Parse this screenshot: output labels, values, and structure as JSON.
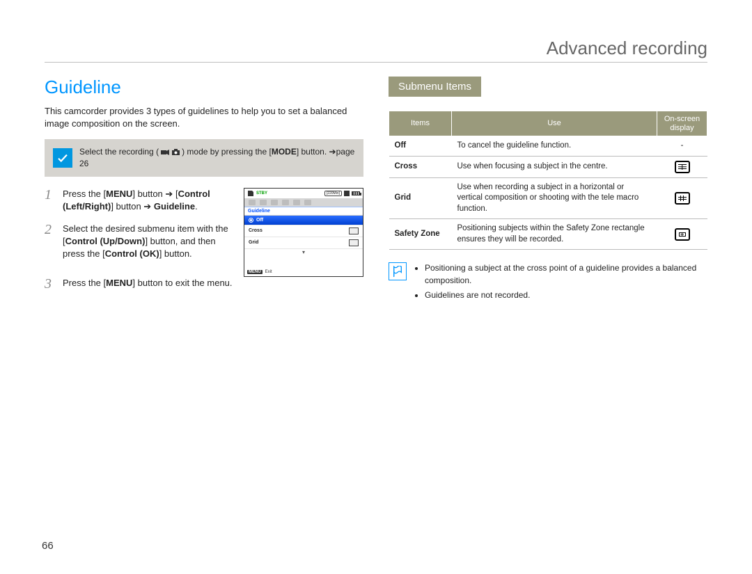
{
  "chapter_title": "Advanced recording",
  "section_title": "Guideline",
  "intro": "This camcorder provides 3 types of guidelines to help you to set a balanced image composition on the screen.",
  "callout": {
    "prefix": "Select the recording (",
    "suffix": ") mode by pressing the [",
    "bold": "MODE",
    "after": "] button. ",
    "arrow": "➔",
    "page_ref": "page 26"
  },
  "steps": [
    {
      "num": "1",
      "parts": {
        "a": "Press the [",
        "a_bold": "MENU",
        "b": "] button ",
        "arrow1": "➔",
        "c": " [",
        "c_bold": "Control (Left/Right)",
        "d": "] button ",
        "arrow2": "➔",
        "e_bold": "Guideline",
        "f": "."
      }
    },
    {
      "num": "2",
      "parts": {
        "a": "Select the desired submenu item with the [",
        "a_bold": "Control (Up/Down)",
        "b": "] button, and then press the [",
        "b_bold": "Control (OK)",
        "c": "] button."
      }
    },
    {
      "num": "3",
      "parts": {
        "a": "Press the [",
        "a_bold": "MENU",
        "b": "] button to exit the menu."
      }
    }
  ],
  "lcd": {
    "stby": "STBY",
    "time": "[220Min]",
    "tab": "Guideline",
    "options": [
      "Off",
      "Cross",
      "Grid"
    ],
    "exit_btn": "MENU",
    "exit_label": "Exit"
  },
  "submenu_heading": "Submenu Items",
  "table": {
    "headers": {
      "items": "Items",
      "use": "Use",
      "display": "On-screen display"
    },
    "rows": [
      {
        "item": "Off",
        "use": "To cancel the guideline function.",
        "icon": "dash"
      },
      {
        "item": "Cross",
        "use": "Use when focusing a subject in the centre.",
        "icon": "cross"
      },
      {
        "item": "Grid",
        "use": "Use when recording a subject in a horizontal or vertical composition or shooting with the tele macro function.",
        "icon": "grid"
      },
      {
        "item": "Safety Zone",
        "use": "Positioning subjects within the Safety Zone rectangle ensures they will be recorded.",
        "icon": "safety"
      }
    ]
  },
  "notes": [
    "Positioning a subject at the cross point of a guideline provides a balanced composition.",
    "Guidelines are not recorded."
  ],
  "page_number": "66"
}
